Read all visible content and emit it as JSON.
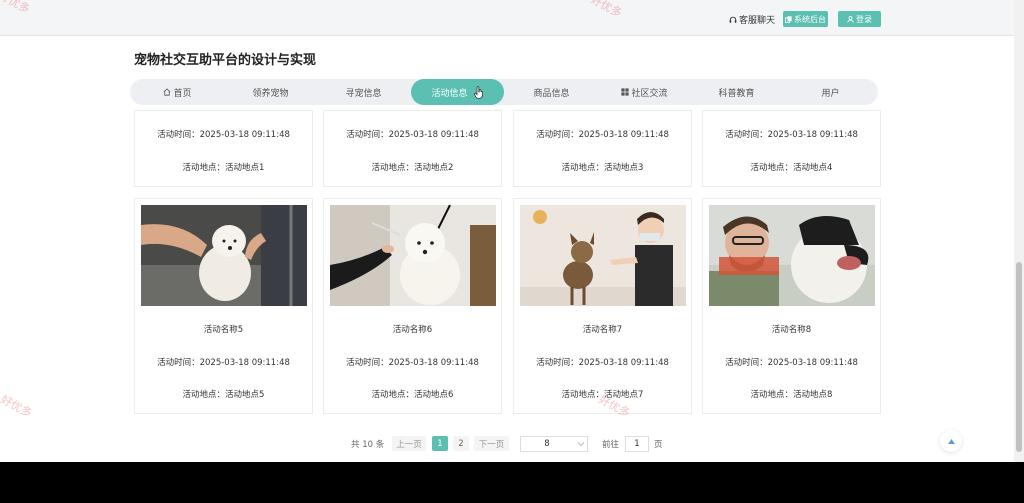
{
  "header": {
    "chat_label": "客服聊天",
    "admin_label": "系统后台",
    "login_label": "登录"
  },
  "site_title": "宠物社交互助平台的设计与实现",
  "nav": {
    "items": [
      "首页",
      "领养宠物",
      "寻宠信息",
      "活动信息",
      "商品信息",
      "社区交流",
      "科普教育",
      "用户"
    ],
    "active": "活动信息"
  },
  "activities": [
    {
      "name": "",
      "time": "活动时间：2025-03-18 09:11:48",
      "place": "活动地点：活动地点1"
    },
    {
      "name": "",
      "time": "活动时间：2025-03-18 09:11:48",
      "place": "活动地点：活动地点2"
    },
    {
      "name": "",
      "time": "活动时间：2025-03-18 09:11:48",
      "place": "活动地点：活动地点3"
    },
    {
      "name": "",
      "time": "活动时间：2025-03-18 09:11:48",
      "place": "活动地点：活动地点4"
    },
    {
      "name": "活动名称5",
      "time": "活动时间：2025-03-18 09:11:48",
      "place": "活动地点：活动地点5"
    },
    {
      "name": "活动名称6",
      "time": "活动时间：2025-03-18 09:11:48",
      "place": "活动地点：活动地点6"
    },
    {
      "name": "活动名称7",
      "time": "活动时间：2025-03-18 09:11:48",
      "place": "活动地点：活动地点7"
    },
    {
      "name": "活动名称8",
      "time": "活动时间：2025-03-18 09:11:48",
      "place": "活动地点：活动地点8"
    }
  ],
  "pagination": {
    "total": "共 10 条",
    "prev": "上一页",
    "pages": [
      "1",
      "2"
    ],
    "current": "1",
    "next": "下一页",
    "page_size": "8",
    "goto_label": "前往",
    "goto_value": "1",
    "page_unit": "页"
  },
  "watermark": "好优多",
  "colors": {
    "accent": "#5bbfb2"
  }
}
